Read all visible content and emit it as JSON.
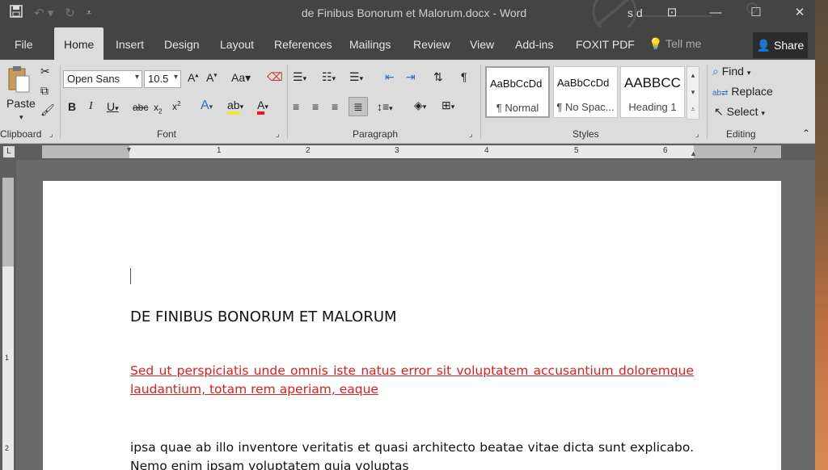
{
  "window": {
    "title": "de Finibus Bonorum et Malorum.docx - Word",
    "user": "s d"
  },
  "tabs": [
    "File",
    "Home",
    "Insert",
    "Design",
    "Layout",
    "References",
    "Mailings",
    "Review",
    "View",
    "Add-ins",
    "FOXIT PDF"
  ],
  "tell_me": "Tell me",
  "share_label": "Share",
  "clipboard": {
    "paste_label": "Paste",
    "group_label": "Clipboard"
  },
  "font": {
    "name": "Open Sans",
    "size": "10.5",
    "group_label": "Font"
  },
  "paragraph": {
    "group_label": "Paragraph"
  },
  "styles": {
    "group_label": "Styles",
    "items": [
      {
        "preview": "AaBbCcDd",
        "name": "¶ Normal"
      },
      {
        "preview": "AaBbCcDd",
        "name": "¶ No Spac..."
      },
      {
        "preview": "AABBCC",
        "name": "Heading 1"
      }
    ]
  },
  "editing": {
    "group_label": "Editing",
    "find_label": "Find",
    "replace_label": "Replace",
    "select_label": "Select"
  },
  "ruler": {
    "numbers": [
      "1",
      "2",
      "3",
      "4",
      "5",
      "6",
      "7"
    ]
  },
  "vruler": {
    "numbers": [
      "1",
      "2"
    ]
  },
  "document": {
    "heading": "DE FINIBUS BONORUM ET MALORUM",
    "red_paragraph": "Sed ut perspiciatis unde omnis iste natus error sit voluptatem accusantium doloremque laudantium, totam rem aperiam, eaque",
    "body_paragraph": " ipsa quae ab illo inventore veritatis et quasi architecto beatae vitae dicta sunt explicabo. Nemo enim ipsam voluptatem quia voluptas"
  },
  "colors": {
    "ribbon": "#dcdcdc",
    "titlebar": "#444444",
    "red_text": "#e31b1b"
  }
}
